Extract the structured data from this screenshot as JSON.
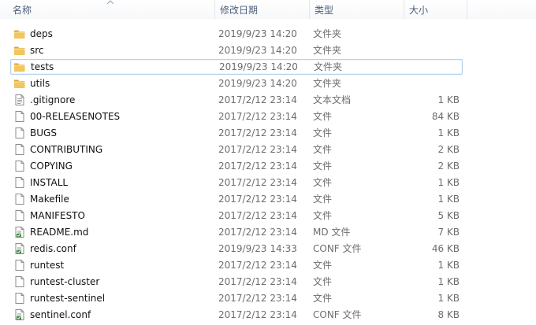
{
  "columns": {
    "name": "名称",
    "date": "修改日期",
    "type": "类型",
    "size": "大小"
  },
  "files": [
    {
      "name": "deps",
      "date": "2019/9/23 14:20",
      "type": "文件夹",
      "size": "",
      "icon": "folder-icon"
    },
    {
      "name": "src",
      "date": "2019/9/23 14:20",
      "type": "文件夹",
      "size": "",
      "icon": "folder-icon"
    },
    {
      "name": "tests",
      "date": "2019/9/23 14:20",
      "type": "文件夹",
      "size": "",
      "icon": "folder-icon",
      "selected": true
    },
    {
      "name": "utils",
      "date": "2019/9/23 14:20",
      "type": "文件夹",
      "size": "",
      "icon": "folder-icon"
    },
    {
      "name": ".gitignore",
      "date": "2017/2/12 23:14",
      "type": "文本文档",
      "size": "1 KB",
      "icon": "text-document-icon"
    },
    {
      "name": "00-RELEASENOTES",
      "date": "2017/2/12 23:14",
      "type": "文件",
      "size": "84 KB",
      "icon": "file-icon"
    },
    {
      "name": "BUGS",
      "date": "2017/2/12 23:14",
      "type": "文件",
      "size": "1 KB",
      "icon": "file-icon"
    },
    {
      "name": "CONTRIBUTING",
      "date": "2017/2/12 23:14",
      "type": "文件",
      "size": "2 KB",
      "icon": "file-icon"
    },
    {
      "name": "COPYING",
      "date": "2017/2/12 23:14",
      "type": "文件",
      "size": "2 KB",
      "icon": "file-icon"
    },
    {
      "name": "INSTALL",
      "date": "2017/2/12 23:14",
      "type": "文件",
      "size": "1 KB",
      "icon": "file-icon"
    },
    {
      "name": "Makefile",
      "date": "2017/2/12 23:14",
      "type": "文件",
      "size": "1 KB",
      "icon": "file-icon"
    },
    {
      "name": "MANIFESTO",
      "date": "2017/2/12 23:14",
      "type": "文件",
      "size": "5 KB",
      "icon": "file-icon"
    },
    {
      "name": "README.md",
      "date": "2017/2/12 23:14",
      "type": "MD 文件",
      "size": "7 KB",
      "icon": "config-file-icon"
    },
    {
      "name": "redis.conf",
      "date": "2019/9/23 14:33",
      "type": "CONF 文件",
      "size": "46 KB",
      "icon": "config-file-icon"
    },
    {
      "name": "runtest",
      "date": "2017/2/12 23:14",
      "type": "文件",
      "size": "1 KB",
      "icon": "file-icon"
    },
    {
      "name": "runtest-cluster",
      "date": "2017/2/12 23:14",
      "type": "文件",
      "size": "1 KB",
      "icon": "file-icon"
    },
    {
      "name": "runtest-sentinel",
      "date": "2017/2/12 23:14",
      "type": "文件",
      "size": "1 KB",
      "icon": "file-icon"
    },
    {
      "name": "sentinel.conf",
      "date": "2017/2/12 23:14",
      "type": "CONF 文件",
      "size": "8 KB",
      "icon": "config-file-icon"
    }
  ],
  "colors": {
    "folder": "#e8b84a",
    "selection_border": "#b4d2ee",
    "header_text": "#4c607a"
  }
}
